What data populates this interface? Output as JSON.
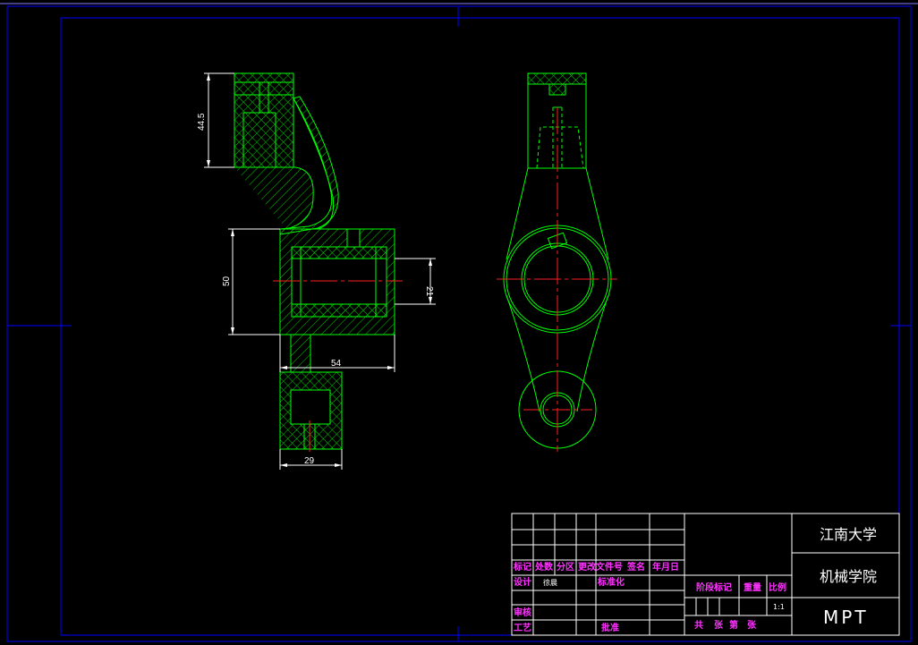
{
  "drawing": {
    "dimensions": {
      "d_44_5": "44.5",
      "d_50": "50",
      "d_21": "21",
      "d_54": "54",
      "d_29": "29"
    },
    "title_block": {
      "school": "江南大学",
      "department": "机械学院",
      "part_name": "MPT",
      "scale_value": "1:1",
      "labels": {
        "mark": "标记",
        "count": "处数",
        "zone": "分区",
        "change_doc": "更改文件号",
        "signature": "签名",
        "date": "年月日",
        "design": "设计",
        "designer": "徐晨",
        "standardize": "标准化",
        "stage_mark": "阶段标记",
        "weight": "重量",
        "scale": "比例",
        "review": "审核",
        "process": "工艺",
        "approve": "批准",
        "sheets_total": "共",
        "sheets_unit1": "张",
        "sheet_no": "第",
        "sheets_unit2": "张"
      }
    },
    "colors": {
      "background": "#000000",
      "outline": "#00ff00",
      "centerline": "#ff2020",
      "border": "#0000ff",
      "text": "#ffffff",
      "titleblock_text": "#ff33ff"
    }
  }
}
